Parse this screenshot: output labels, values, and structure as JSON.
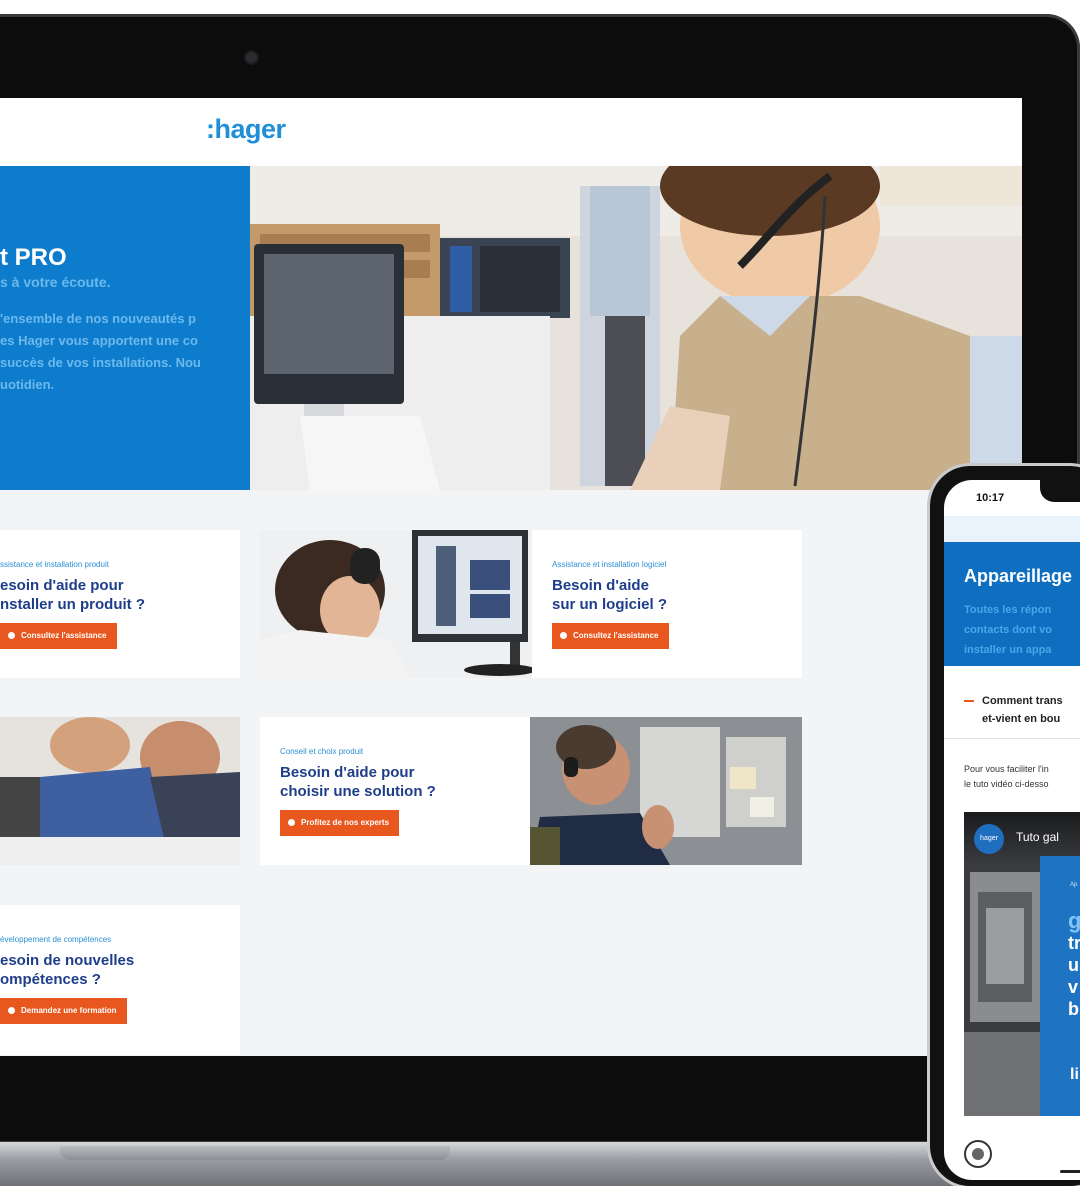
{
  "site": {
    "logo": ":hager"
  },
  "hero": {
    "title": "t PRO",
    "subtitle": "s à votre écoute.",
    "body_lines": [
      "'ensemble de nos nouveautés p",
      "es Hager vous apportent une co",
      "succès de vos installations. Nou",
      "uotidien."
    ]
  },
  "cards": [
    {
      "kicker": "ssistance et installation produit",
      "heading_lines": [
        "esoin d'aide pour",
        "nstaller un produit ?"
      ],
      "button": "Consultez l'assistance"
    },
    {
      "kicker": "Assistance et installation logiciel",
      "heading_lines": [
        "Besoin d'aide",
        "sur un logiciel ?"
      ],
      "button": "Consultez l'assistance"
    },
    {
      "kicker": "Conseil et choix produit",
      "heading_lines": [
        "Besoin d'aide pour",
        "choisir une solution ?"
      ],
      "button": "Profitez de nos experts"
    },
    {
      "kicker": "éveloppement de compétences",
      "heading_lines": [
        "esoin de nouvelles",
        "ompétences ?"
      ],
      "button": "Demandez une formation"
    }
  ],
  "phone": {
    "time": "10:17",
    "title": "Appareillage",
    "desc_lines": [
      "Toutes les répon",
      "contacts dont vo",
      "installer un appa"
    ],
    "question_lines": [
      "Comment trans",
      "et-vient en bou"
    ],
    "note_lines": [
      "Pour vous faciliter l'in",
      "le tuto vidéo ci-desso"
    ],
    "video": {
      "logo": "hager",
      "title": "Tuto gal",
      "panel_small": "Ap",
      "panel_big": [
        "g",
        "tr",
        "u",
        "v",
        "b"
      ],
      "panel_bottom": "li"
    }
  },
  "colors": {
    "brand_blue": "#0e7ccc",
    "heading_navy": "#1f3e8a",
    "button_orange": "#e8571d"
  }
}
